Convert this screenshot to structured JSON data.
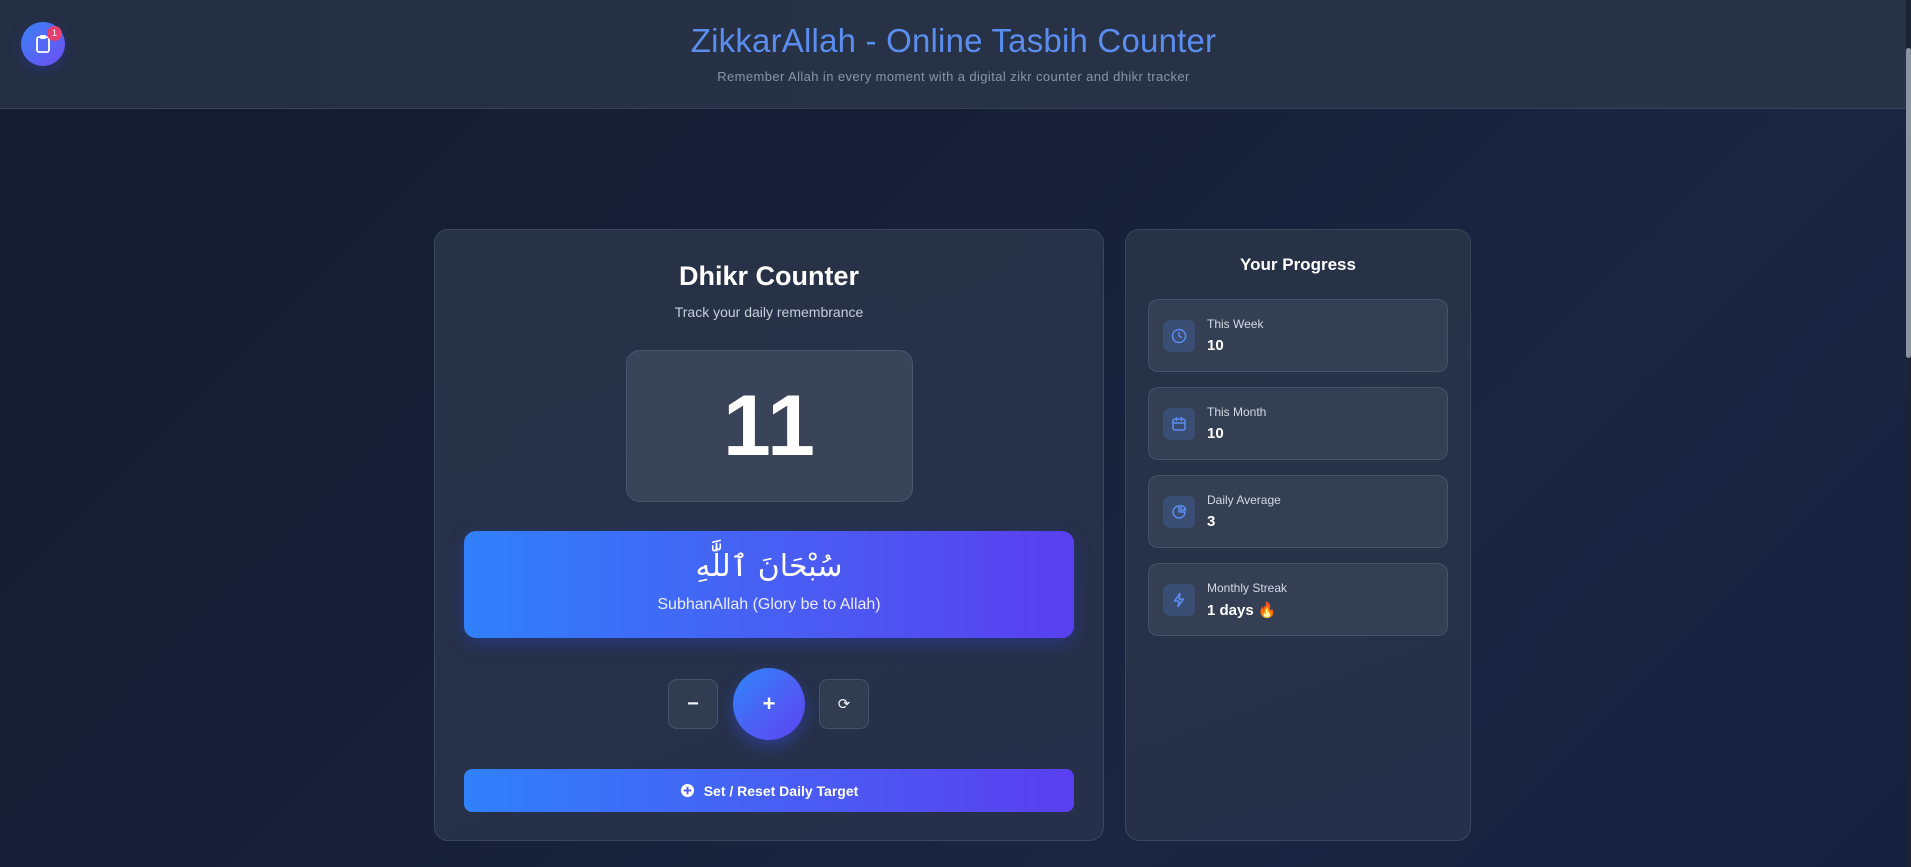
{
  "header": {
    "title": "ZikkarAllah - Online Tasbih Counter",
    "subtitle": "Remember Allah in every moment with a digital zikr counter and dhikr tracker",
    "notification_count": "1"
  },
  "counter": {
    "title": "Dhikr Counter",
    "subtitle": "Track your daily remembrance",
    "count": "11",
    "dhikr_arabic": "سُبْحَانَ ٱللَّٰهِ",
    "dhikr_transliteration": "SubhanAllah (Glory be to Allah)",
    "minus_label": "−",
    "plus_label": "+",
    "reset_label": "⟳",
    "target_button_label": "Set / Reset Daily Target"
  },
  "progress": {
    "title": "Your Progress",
    "stats": [
      {
        "label": "This Week",
        "value": "10",
        "icon": "clock-icon"
      },
      {
        "label": "This Month",
        "value": "10",
        "icon": "calendar-icon"
      },
      {
        "label": "Daily Average",
        "value": "3",
        "icon": "pie-chart-icon"
      },
      {
        "label": "Monthly Streak",
        "value": "1 days 🔥",
        "icon": "lightning-icon"
      }
    ]
  },
  "colors": {
    "accent_blue": "#3080fb",
    "accent_purple": "#5a3ff0",
    "title_blue": "#5b8def",
    "badge_red": "#e43f6f"
  }
}
